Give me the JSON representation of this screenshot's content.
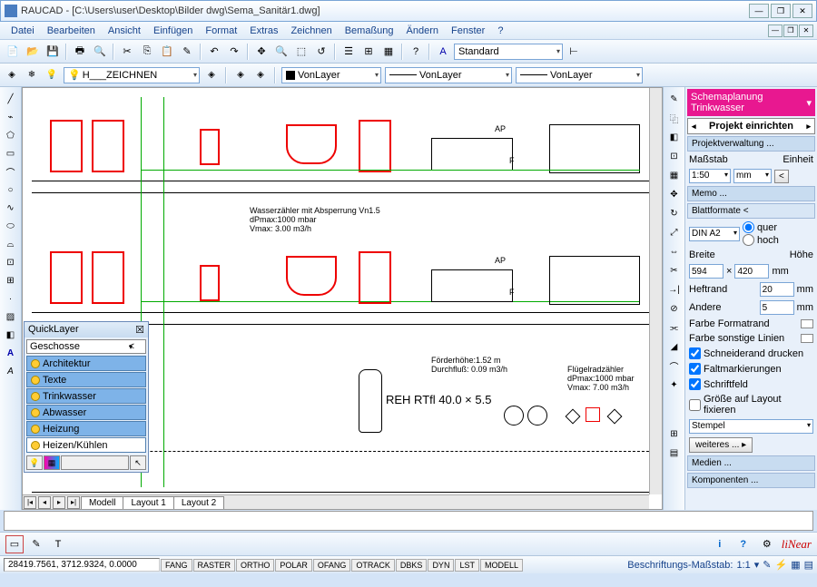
{
  "app": {
    "title": "RAUCAD - [C:\\Users\\user\\Desktop\\Bilder dwg\\Sema_Sanitär1.dwg]",
    "winbtns": {
      "min": "—",
      "restore": "❐",
      "close": "✕"
    }
  },
  "menu": [
    "Datei",
    "Bearbeiten",
    "Ansicht",
    "Einfügen",
    "Format",
    "Extras",
    "Zeichnen",
    "Bemaßung",
    "Ändern",
    "Fenster",
    "?"
  ],
  "toolbar1": {
    "style_combo": "Standard"
  },
  "toolbar2": {
    "layer": "H___ZEICHNEN",
    "bylayer1": "VonLayer",
    "bylayer2": "VonLayer",
    "bylayer3": "VonLayer"
  },
  "tabs": [
    "Modell",
    "Layout 1",
    "Layout 2"
  ],
  "quicklayer": {
    "title": "QuickLayer",
    "combo": "Geschosse",
    "items": [
      "Architektur",
      "Texte",
      "Trinkwasser",
      "Abwasser",
      "Heizung",
      "Heizen/Kühlen"
    ]
  },
  "rpanel": {
    "schema": "Schemaplanung Trinkwasser",
    "nav": "Projekt einrichten",
    "projverw": "Projektverwaltung ...",
    "massstab_lbl": "Maßstab",
    "einheit_lbl": "Einheit",
    "massstab": "1:50",
    "einheit": "mm",
    "memo": "Memo ...",
    "blatt": "Blattformate <",
    "format": "DIN A2",
    "quer": "quer",
    "hoch": "hoch",
    "breite_lbl": "Breite",
    "hoehe_lbl": "Höhe",
    "breite": "594",
    "hoehe": "420",
    "unit_mm": "mm",
    "heftrand_lbl": "Heftrand",
    "heftrand": "20",
    "andere_lbl": "Andere",
    "andere": "5",
    "farbe_format": "Farbe Formatrand",
    "farbe_sonst": "Farbe sonstige Linien",
    "chk1": "Schneiderand drucken",
    "chk2": "Faltmarkierungen",
    "chk3": "Schriftfeld",
    "chk4": "Größe auf Layout fixieren",
    "stempel": "Stempel",
    "weiteres": "weiteres ... ▸",
    "medien": "Medien ...",
    "komponenten": "Komponenten ..."
  },
  "bottom": {
    "logo": "liNear"
  },
  "status": {
    "coord": "28419.7561, 3712.9324, 0.0000",
    "btns": [
      "FANG",
      "RASTER",
      "ORTHO",
      "POLAR",
      "OFANG",
      "OTRACK",
      "DBKS",
      "DYN",
      "LST",
      "MODELL"
    ],
    "scale_lbl": "Beschriftungs-Maßstab:",
    "scale": "1:1"
  },
  "drawing": {
    "note1": "Wasserzähler mit Absperrung Vn1.5\ndPmax:1000 mbar\nVmax: 3.00 m3/h",
    "note2": "Förderhöhe:1.52 m\nDurchfluß: 0.09 m3/h",
    "note3": "Flügelradzähler\ndPmax:1000 mbar\nVmax: 7.00 m3/h",
    "reh": "REH RTfl 40.0 × 5.5",
    "ap": "AP",
    "f": "F"
  }
}
